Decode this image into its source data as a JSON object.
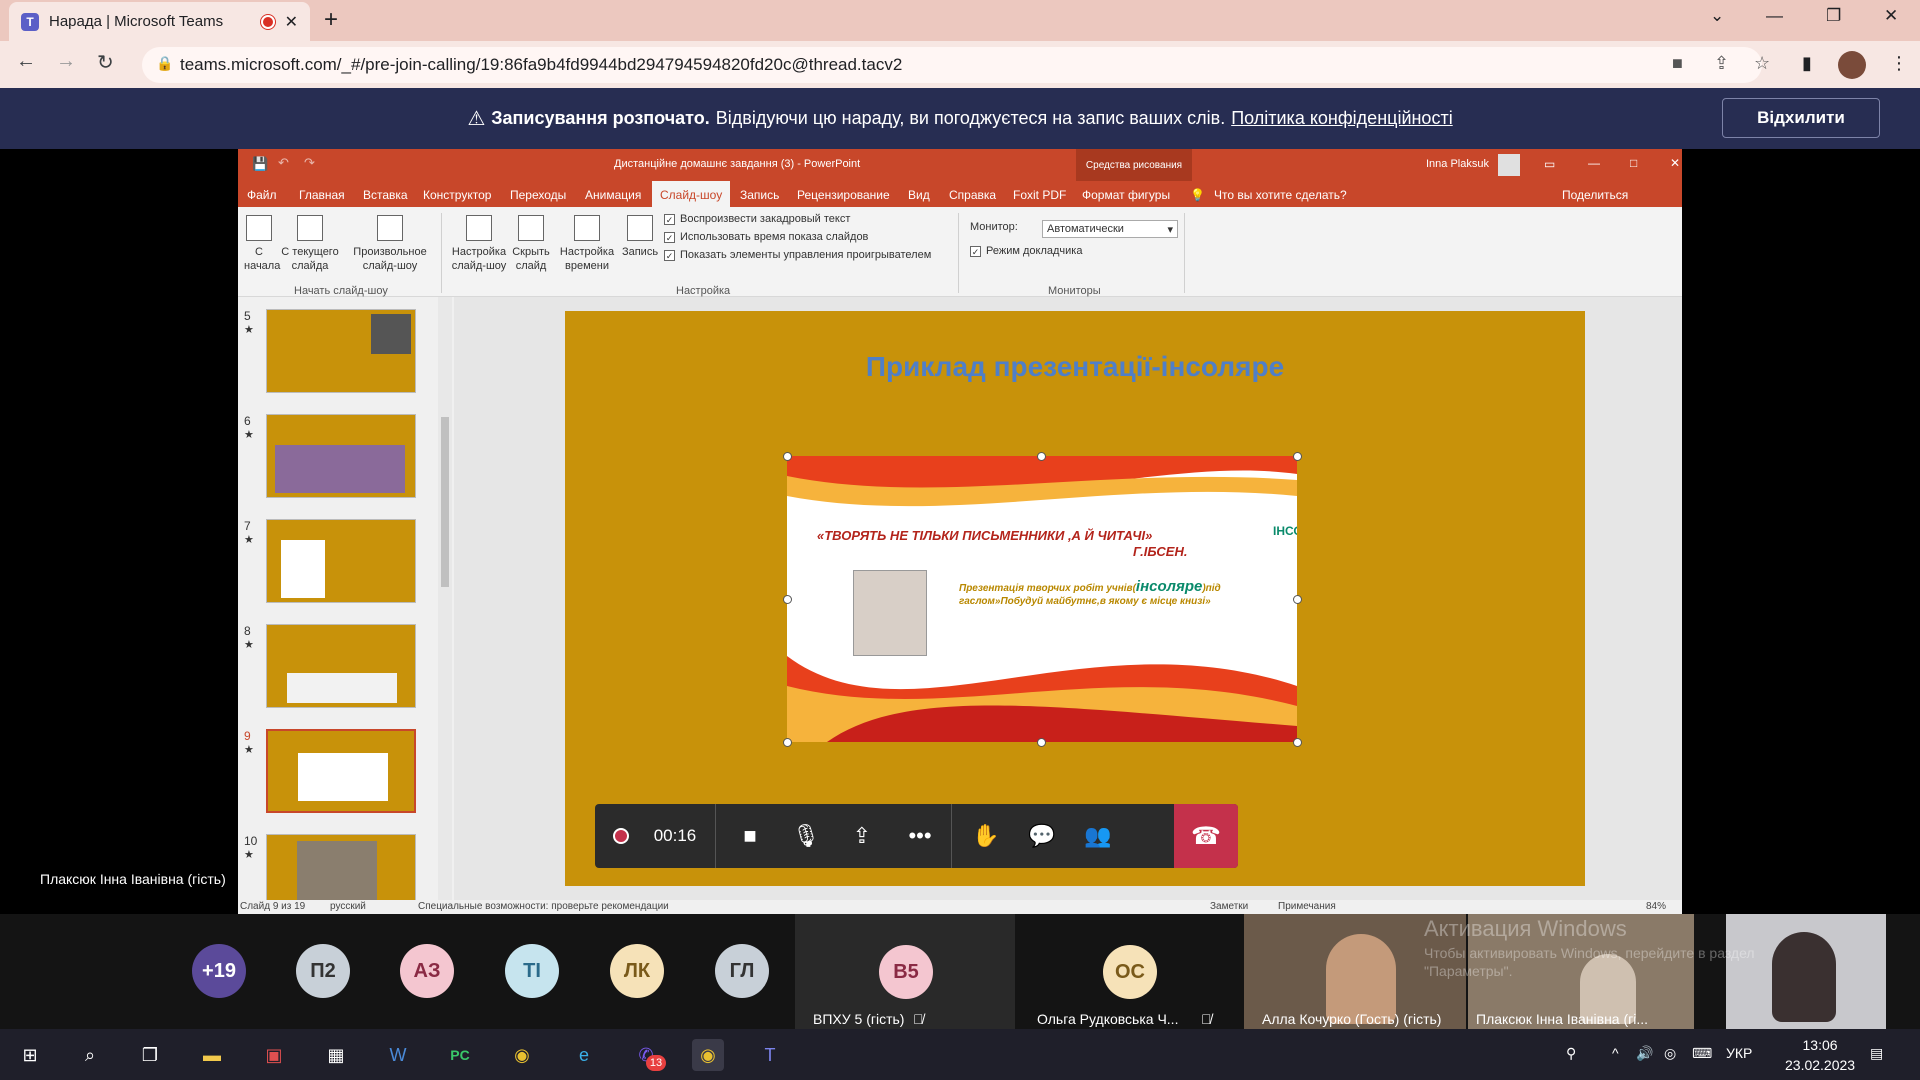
{
  "browser": {
    "tab_title": "Нарада | Microsoft Teams",
    "url": "teams.microsoft.com/_#/pre-join-calling/19:86fa9b4fd9944bd294794594820fd20c@thread.tacv2"
  },
  "banner": {
    "bold": "Записування розпочато.",
    "text": "Відвідуючи цю нараду, ви погоджуєтеся на запис ваших слів.",
    "link": "Політика конфіденційності",
    "dismiss": "Відхилити"
  },
  "ppt": {
    "title": "Дистанційне домашнє завдання (3)  -  PowerPoint",
    "tools_label": "Средства рисования",
    "user": "Inna Plaksuk",
    "tabs": [
      "Файл",
      "Главная",
      "Вставка",
      "Конструктор",
      "Переходы",
      "Анимация",
      "Слайд-шоу",
      "Запись",
      "Рецензирование",
      "Вид",
      "Справка",
      "Foxit PDF",
      "Формат фигуры"
    ],
    "tell_me": "Что вы хотите сделать?",
    "share": "Поделиться",
    "ribbon": {
      "from_start": "С начала",
      "from_current": "С текущего слайда",
      "custom": "Произвольное слайд-шоу",
      "group_start": "Начать слайд-шоу",
      "setup": "Настройка слайд-шоу",
      "hide": "Скрыть слайд",
      "timing": "Настройка времени",
      "record": "Запись",
      "chk1": "Воспроизвести закадровый текст",
      "chk2": "Использовать время показа слайдов",
      "chk3": "Показать элементы управления проигрывателем",
      "group_setup": "Настройка",
      "monitor_label": "Монитор:",
      "monitor_value": "Автоматически",
      "presenter_view": "Режим докладчика",
      "group_monitors": "Мониторы"
    },
    "thumbs": [
      "5",
      "6",
      "7",
      "8",
      "9",
      "10"
    ],
    "slide": {
      "title": "Приклад презентації-інсоляре",
      "quote": "«ТВОРЯТЬ НЕ ТІЛЬКИ ПИСЬМЕННИКИ ,А Й ЧИТАЧІ»",
      "author": "Г.ІБСЕН.",
      "desc_before": "Презентація творчих робіт учнів(",
      "insolyare": "інсоляре",
      "desc_after": ")під гаслом»Побудуй майбутнє,в якому є місце книзі»",
      "vertical": "ІНСОЛЯРЕ"
    },
    "status": {
      "slide": "Слайд 9 из 19",
      "lang": "русский",
      "accessibility": "Специальные возможности: проверьте рекомендации",
      "notes": "Заметки",
      "comments": "Примечания",
      "zoom": "84%"
    }
  },
  "call": {
    "timer": "00:16",
    "presenter": "Плаксюк Інна Іванівна (гість)"
  },
  "participants": {
    "more": "+19",
    "avatars": [
      {
        "initials": "П2",
        "color": "#c8d0d8"
      },
      {
        "initials": "АЗ",
        "color": "#f4c6d0"
      },
      {
        "initials": "ТІ",
        "color": "#c6e4ee"
      },
      {
        "initials": "ЛК",
        "color": "#f6e2b8"
      },
      {
        "initials": "ГЛ",
        "color": "#c8d0d8"
      }
    ],
    "tiles": [
      {
        "initials": "В5",
        "name": "ВПХУ 5 (гість)",
        "color": "#f4c6d0"
      },
      {
        "initials": "ОС",
        "name": "Ольга Рудковська Ч...",
        "color": "#f6e2b8"
      }
    ],
    "videos": [
      {
        "name": "Алла Кочурко (Гость) (гість)"
      },
      {
        "name": "Плаксюк Інна Іванівна (гі..."
      }
    ],
    "watermark_1": "Активация Windows",
    "watermark_2": "Чтобы активировать Windows, перейдите в раздел \"Параметры\"."
  },
  "taskbar": {
    "lang": "УКР",
    "time": "13:06",
    "date": "23.02.2023",
    "badge": "13"
  }
}
